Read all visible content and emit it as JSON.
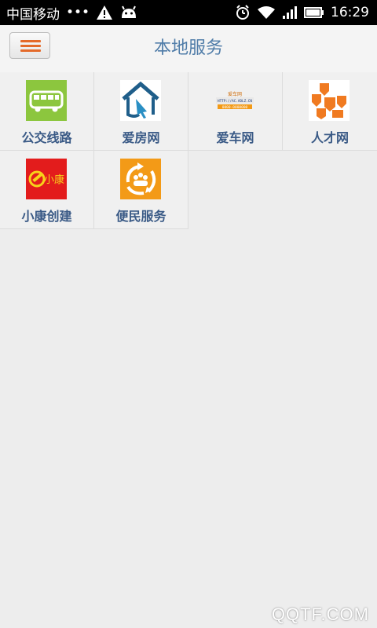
{
  "status_bar": {
    "carrier": "中国移动",
    "dots": "•••",
    "time": "16:29"
  },
  "header": {
    "title": "本地服务",
    "menu_icon": "hamburger-menu-icon"
  },
  "services": [
    {
      "label": "公交线路",
      "icon": "bus-icon"
    },
    {
      "label": "爱房网",
      "icon": "house-arrow-icon"
    },
    {
      "label": "爱车网",
      "icon": "car-site-logo-icon",
      "logo_lines": [
        "爱车网",
        "HTTP://AC.ADLZ.CN",
        "0000-0000000"
      ]
    },
    {
      "label": "人才网",
      "icon": "orange-blocks-icon"
    },
    {
      "label": "小康创建",
      "icon": "party-emblem-icon",
      "logo_text": "小康"
    },
    {
      "label": "便民服务",
      "icon": "recycle-people-icon"
    }
  ],
  "watermark": "QQTF.COM",
  "colors": {
    "header_title": "#4f7ca8",
    "label": "#3a5a86",
    "menu_bar": "#e46a2a",
    "bus_bg": "#8cc63e",
    "party_bg": "#e31c1c",
    "service_bg": "#f39a17"
  }
}
